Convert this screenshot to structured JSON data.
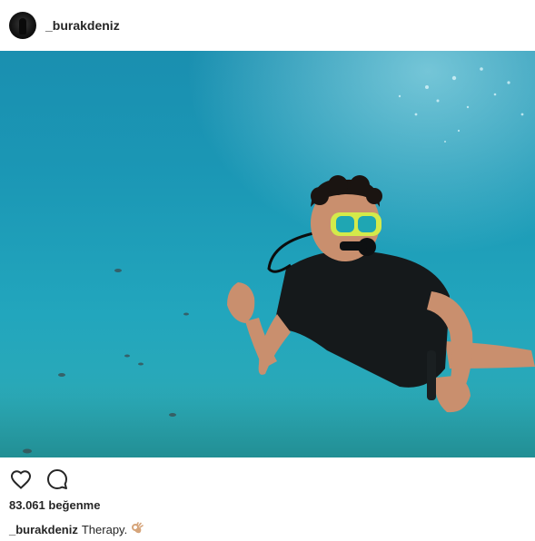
{
  "post": {
    "username": "_burakdeniz",
    "likes_text": "83.061 beğenme",
    "caption": {
      "username": "_burakdeniz",
      "text": "Therapy."
    },
    "caption_emoji_icon": "ok-hand-emoji-icon"
  },
  "icons": {
    "like": "heart-icon",
    "comment": "comment-icon"
  },
  "colors": {
    "water_top": "#1a8fb0",
    "water_bottom": "#2aa9b8",
    "text": "#262626"
  }
}
